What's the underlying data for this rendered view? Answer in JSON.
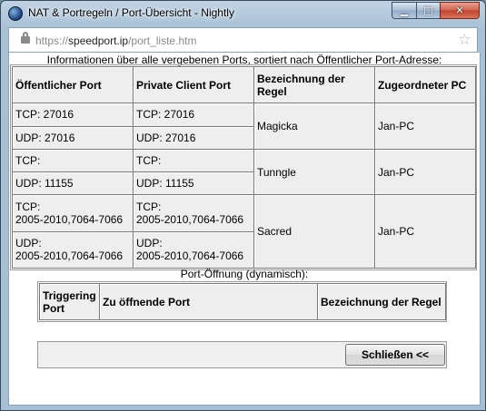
{
  "window": {
    "title": "NAT & Portregeln / Port-Übersicht - Nightly",
    "controls": {
      "minimize": "▁",
      "maximize": "□",
      "close": "✕"
    }
  },
  "urlbar": {
    "scheme": "https://",
    "domain": "speedport.ip",
    "path": "/port_liste.htm",
    "icons": [
      "lock-icon",
      "bookmark-star-icon"
    ]
  },
  "ports_section": {
    "caption": "Informationen über alle vergebenen Ports, sortiert nach Öffentlicher Port-Adresse:",
    "headers": [
      "Öffentlicher Port",
      "Private Client Port",
      "Bezeichnung der Regel",
      "Zugeordneter PC"
    ],
    "rules": [
      {
        "name": "Magicka",
        "pc": "Jan-PC",
        "tcp_public": "TCP: 27016",
        "tcp_private": "TCP: 27016",
        "udp_public": "UDP: 27016",
        "udp_private": "UDP: 27016"
      },
      {
        "name": "Tunngle",
        "pc": "Jan-PC",
        "tcp_public": "TCP:",
        "tcp_private": "TCP:",
        "udp_public": "UDP: 11155",
        "udp_private": "UDP: 11155"
      },
      {
        "name": "Sacred",
        "pc": "Jan-PC",
        "tcp_public_1": "TCP:",
        "tcp_public_2": "2005-2010,7064-7066",
        "tcp_private_1": "TCP:",
        "tcp_private_2": "2005-2010,7064-7066",
        "udp_public_1": "UDP:",
        "udp_public_2": "2005-2010,7064-7066",
        "udp_private_1": "UDP:",
        "udp_private_2": "2005-2010,7064-7066"
      }
    ]
  },
  "dynamic_section": {
    "caption": "Port-Öffnung (dynamisch):",
    "headers": [
      "Triggering Port",
      "Zu öffnende Port",
      "Bezeichnung der Regel"
    ],
    "header_triggering_1": "Triggering",
    "header_triggering_2": "Port"
  },
  "footer": {
    "close_button": "Schließen <<"
  }
}
